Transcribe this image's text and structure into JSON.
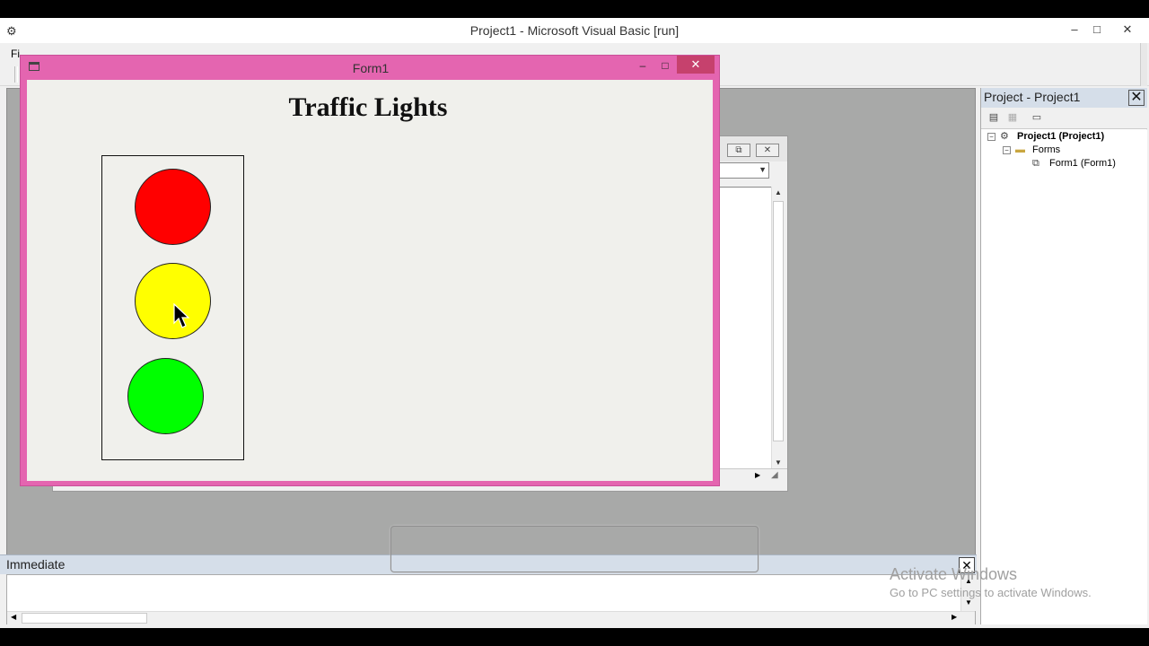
{
  "ide": {
    "title": "Project1 - Microsoft Visual Basic [run]",
    "minimize_glyph": "–",
    "maximize_glyph": "□",
    "close_glyph": "✕",
    "menu_file": "Fi"
  },
  "form": {
    "title": "Form1",
    "minimize_glyph": "–",
    "maximize_glyph": "□",
    "close_glyph": "✕",
    "heading": "Traffic Lights",
    "lights": [
      {
        "name": "red",
        "color": "#ff0000"
      },
      {
        "name": "yellow",
        "color": "#ffff00"
      },
      {
        "name": "green",
        "color": "#00ff00"
      }
    ]
  },
  "code_window": {
    "restore_glyph": "⧉",
    "close_glyph": "✕"
  },
  "immediate": {
    "title": "Immediate",
    "close_glyph": "✕"
  },
  "project_explorer": {
    "title": "Project - Project1",
    "close_glyph": "✕",
    "tree": {
      "project": "Project1 (Project1)",
      "forms_folder": "Forms",
      "form_item": "Form1 (Form1)"
    }
  },
  "watermark": {
    "line1": "Activate Windows",
    "line2": "Go to PC settings to activate Windows."
  },
  "icons": {
    "app": "vb-app-icon",
    "form": "form-window-icon",
    "project": "project-icon",
    "folder": "folder-icon",
    "form_item": "form-item-icon",
    "cursor": "mouse-pointer-icon"
  },
  "colors": {
    "form_frame": "#e465b0",
    "form_close": "#c6416d",
    "mdi_background": "#a8a9a8",
    "panel_title": "#d5dee9"
  }
}
